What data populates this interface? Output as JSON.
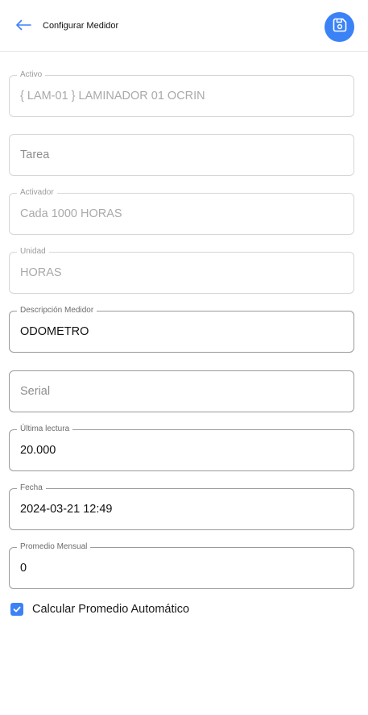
{
  "header": {
    "title": "Configurar Medidor",
    "back_icon": "arrow-left-icon",
    "save_icon": "floppy-disk-icon"
  },
  "colors": {
    "accent": "#3b82f6",
    "border": "#d6d6d6",
    "disabled_text": "#a9a9a9"
  },
  "fields": {
    "activo": {
      "label": "Activo",
      "value": "{ LAM-01 } LAMINADOR 01 OCRIN"
    },
    "tarea": {
      "placeholder": "Tarea",
      "value": ""
    },
    "activador": {
      "label": "Activador",
      "value": "Cada 1000 HORAS"
    },
    "unidad": {
      "label": "Unidad",
      "value": "HORAS"
    },
    "descripcion": {
      "label": "Descripción Medidor",
      "value": "ODOMETRO"
    },
    "serial": {
      "placeholder": "Serial",
      "value": ""
    },
    "ultima_lectura": {
      "label": "Última lectura",
      "value": "20.000"
    },
    "fecha": {
      "label": "Fecha",
      "value": "2024-03-21 12:49"
    },
    "promedio": {
      "label": "Promedio Mensual",
      "value": "0"
    }
  },
  "checkbox": {
    "label": "Calcular Promedio Automático",
    "checked": true
  }
}
